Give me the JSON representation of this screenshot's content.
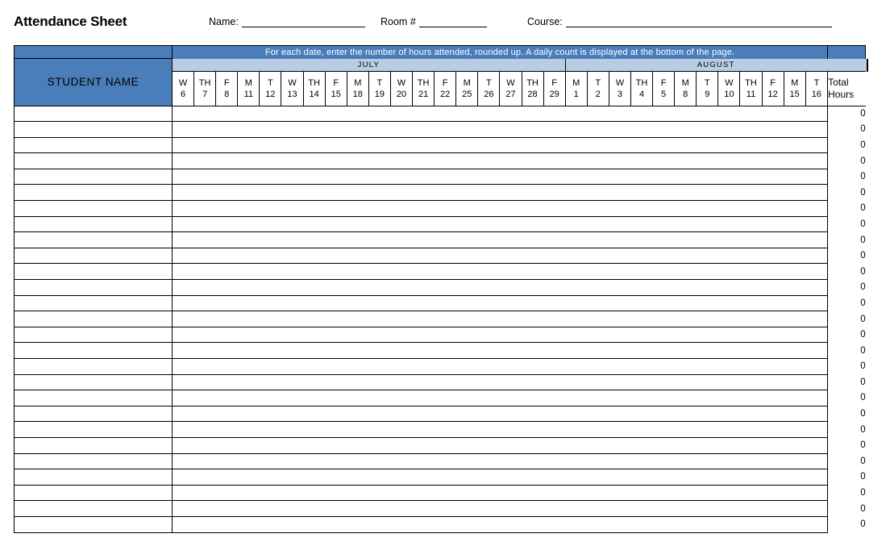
{
  "header": {
    "title": "Attendance Sheet",
    "fields": [
      {
        "label": "Name:",
        "value": ""
      },
      {
        "label": "Room #",
        "value": ""
      },
      {
        "label": "Course:",
        "value": ""
      }
    ]
  },
  "table": {
    "instruction": "For each date, enter the number of hours attended, rounded up. A daily count is displayed at the bottom of the page.",
    "name_column_header": "STUDENT NAME",
    "total_header_line1": "Total",
    "total_header_line2": "Hours",
    "months": [
      {
        "label": "JULY",
        "span": 18
      },
      {
        "label": "AUGUST",
        "span": 14
      }
    ],
    "days": [
      {
        "dow": "W",
        "date": "6"
      },
      {
        "dow": "TH",
        "date": "7"
      },
      {
        "dow": "F",
        "date": "8"
      },
      {
        "dow": "M",
        "date": "11"
      },
      {
        "dow": "T",
        "date": "12"
      },
      {
        "dow": "W",
        "date": "13"
      },
      {
        "dow": "TH",
        "date": "14"
      },
      {
        "dow": "F",
        "date": "15"
      },
      {
        "dow": "M",
        "date": "18"
      },
      {
        "dow": "T",
        "date": "19"
      },
      {
        "dow": "W",
        "date": "20"
      },
      {
        "dow": "TH",
        "date": "21"
      },
      {
        "dow": "F",
        "date": "22"
      },
      {
        "dow": "M",
        "date": "25"
      },
      {
        "dow": "T",
        "date": "26"
      },
      {
        "dow": "W",
        "date": "27"
      },
      {
        "dow": "TH",
        "date": "28"
      },
      {
        "dow": "F",
        "date": "29"
      },
      {
        "dow": "M",
        "date": "1"
      },
      {
        "dow": "T",
        "date": "2"
      },
      {
        "dow": "W",
        "date": "3"
      },
      {
        "dow": "TH",
        "date": "4"
      },
      {
        "dow": "F",
        "date": "5"
      },
      {
        "dow": "M",
        "date": "8"
      },
      {
        "dow": "T",
        "date": "9"
      },
      {
        "dow": "W",
        "date": "10"
      },
      {
        "dow": "TH",
        "date": "11"
      },
      {
        "dow": "F",
        "date": "12"
      },
      {
        "dow": "M",
        "date": "15"
      },
      {
        "dow": "T",
        "date": "16"
      }
    ],
    "rows": [
      {
        "student": "",
        "total": "0"
      },
      {
        "student": "",
        "total": "0"
      },
      {
        "student": "",
        "total": "0"
      },
      {
        "student": "",
        "total": "0"
      },
      {
        "student": "",
        "total": "0"
      },
      {
        "student": "",
        "total": "0"
      },
      {
        "student": "",
        "total": "0"
      },
      {
        "student": "",
        "total": "0"
      },
      {
        "student": "",
        "total": "0"
      },
      {
        "student": "",
        "total": "0"
      },
      {
        "student": "",
        "total": "0"
      },
      {
        "student": "",
        "total": "0"
      },
      {
        "student": "",
        "total": "0"
      },
      {
        "student": "",
        "total": "0"
      },
      {
        "student": "",
        "total": "0"
      },
      {
        "student": "",
        "total": "0"
      },
      {
        "student": "",
        "total": "0"
      },
      {
        "student": "",
        "total": "0"
      },
      {
        "student": "",
        "total": "0"
      },
      {
        "student": "",
        "total": "0"
      },
      {
        "student": "",
        "total": "0"
      },
      {
        "student": "",
        "total": "0"
      },
      {
        "student": "",
        "total": "0"
      },
      {
        "student": "",
        "total": "0"
      },
      {
        "student": "",
        "total": "0"
      },
      {
        "student": "",
        "total": "0"
      },
      {
        "student": "",
        "total": "0"
      }
    ]
  },
  "colors": {
    "header_blue": "#4a7ebb",
    "month_blue": "#b8cce4",
    "text": "#000000",
    "instruction_text": "#ffffff"
  }
}
